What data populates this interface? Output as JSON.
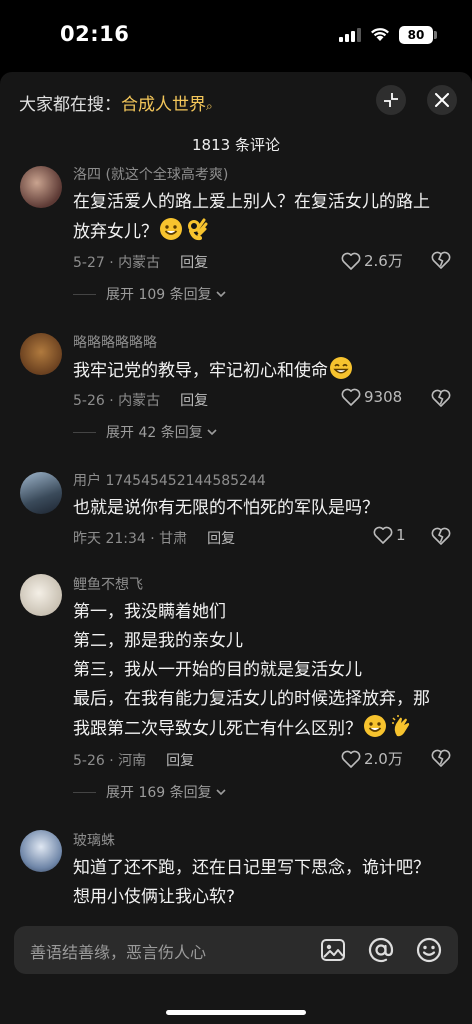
{
  "status_bar": {
    "time": "02:16",
    "battery": "80"
  },
  "header": {
    "search_prefix": "大家都在搜：",
    "search_keyword": "合成人世界",
    "comment_count": "1813 条评论"
  },
  "comments": [
    {
      "username": "洛四 (就这个全球高考爽)",
      "text_line1": "在复活爱人的路上爱上别人？在复活女儿的路上",
      "text_line2": "放弃女儿？",
      "meta": "5-27 · 内蒙古",
      "reply": "回复",
      "likes": "2.6万",
      "expand": "展开 109 条回复"
    },
    {
      "username": "略略略略略略",
      "text_line1": "我牢记党的教导，牢记初心和使命",
      "meta": "5-26 · 内蒙古",
      "reply": "回复",
      "likes": "9308",
      "expand": "展开 42 条回复"
    },
    {
      "username": "用户 174545452144585244",
      "text_line1": "也就是说你有无限的不怕死的军队是吗？",
      "meta": "昨天 21:34 · 甘肃",
      "reply": "回复",
      "likes": "1"
    },
    {
      "username": "鲤鱼不想飞",
      "text_line1": "第一，我没瞒着她们",
      "text_line2": "第二，那是我的亲女儿",
      "text_line3": "第三，我从一开始的目的就是复活女儿",
      "text_line4": "最后，在我有能力复活女儿的时候选择放弃，那",
      "text_line5": "我跟第二次导致女儿死亡有什么区别？",
      "meta": "5-26 · 河南",
      "reply": "回复",
      "likes": "2.0万",
      "expand": "展开 169 条回复"
    },
    {
      "username": "玻璃蛛",
      "text_line1": "知道了还不跑，还在日记里写下思念，诡计吧？",
      "text_line2": "想用小伎俩让我心软?"
    }
  ],
  "input": {
    "placeholder": "善语结善缘，恶言伤人心"
  },
  "icons": {
    "search": "search-icon",
    "fullscreen": "fullscreen-icon",
    "close": "close-icon",
    "like": "heart-icon",
    "dislike": "broken-heart-icon",
    "chevron": "chevron-down-icon",
    "image": "image-icon",
    "mention": "at-icon",
    "emoji": "emoji-icon"
  },
  "colors": {
    "keyword": "#f3c65a",
    "sheet_bg": "#161616",
    "muted": "#8d8d8d"
  }
}
